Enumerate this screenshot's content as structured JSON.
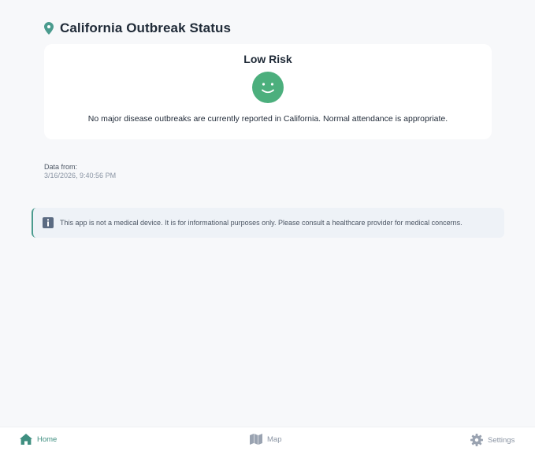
{
  "header": {
    "title": "California Outbreak Status",
    "icon": "location-pin-icon"
  },
  "status_card": {
    "risk_level": "Low Risk",
    "face_icon": "smiley-face-icon",
    "message": "No major disease outbreaks are currently reported in California. Normal attendance is appropriate."
  },
  "data_info": {
    "label": "Data from:",
    "timestamp": "3/16/2026, 9:40:56 PM"
  },
  "notice": {
    "icon": "info-icon",
    "text": "This app is not a medical device. It is for informational purposes only. Please consult a healthcare provider for medical concerns."
  },
  "tabbar": {
    "items": [
      {
        "label": "Home",
        "icon": "home-icon",
        "active": true
      },
      {
        "label": "Map",
        "icon": "map-icon",
        "active": false
      },
      {
        "label": "Settings",
        "icon": "gear-icon",
        "active": false
      }
    ]
  },
  "colors": {
    "accent": "#3f8f80",
    "status_green": "#4caf7d",
    "background": "#f7f8fa"
  }
}
